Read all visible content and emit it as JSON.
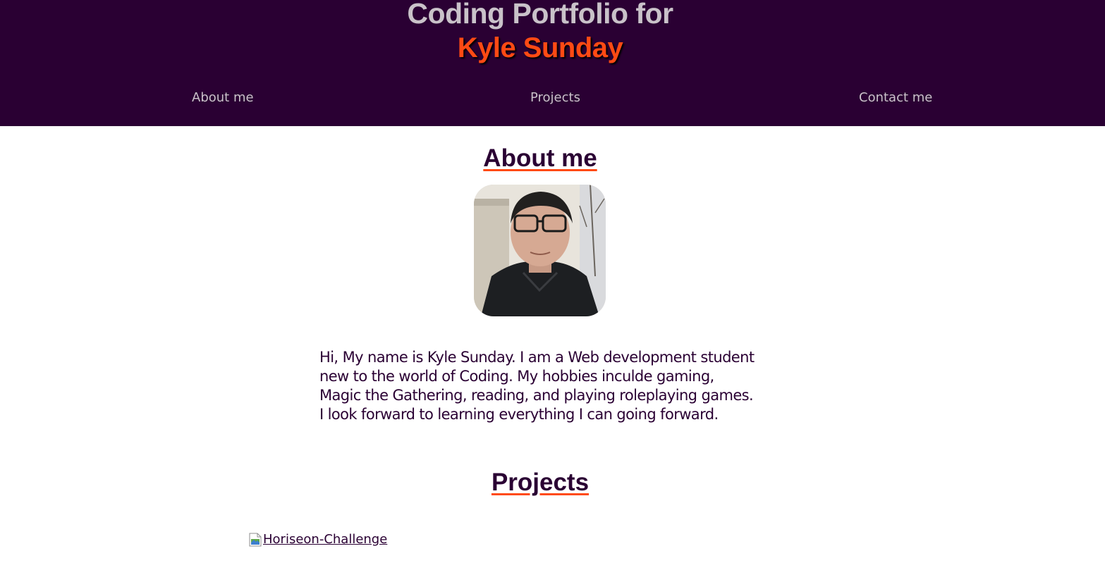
{
  "header": {
    "title_line1": "Coding Portfolio for",
    "title_line2": "Kyle Sunday"
  },
  "nav": {
    "items": [
      {
        "label": "About me"
      },
      {
        "label": "Projects"
      },
      {
        "label": "Contact me"
      }
    ]
  },
  "about": {
    "heading": "About me",
    "bio": "Hi, My name is Kyle Sunday. I am a Web development student new to the world of Coding. My hobbies inculde gaming, Magic the Gathering, reading, and playing roleplaying games. I look forward to learning everything I can going forward."
  },
  "projects": {
    "heading": "Projects",
    "items": [
      {
        "alt": "Horiseon-Challenge"
      }
    ]
  },
  "colors": {
    "header_bg": "#2a0033",
    "accent": "#ff4a14",
    "muted_text": "#c9c2c9",
    "body_text": "#2a0033"
  },
  "icons": {
    "broken_image": "broken-image-icon"
  }
}
